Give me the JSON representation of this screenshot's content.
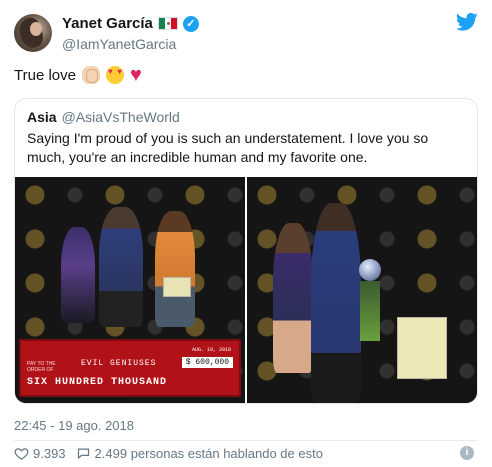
{
  "author": {
    "display_name": "Yanet García",
    "handle": "@IamYanetGarcia",
    "verified_icon": "check-icon"
  },
  "tweet": {
    "text": "True love",
    "emojis": [
      "clapping-hands-icon",
      "heart-eyes-icon",
      "red-heart-icon"
    ]
  },
  "quoted": {
    "name": "Asia",
    "handle": "@AsiaVsTheWorld",
    "text": "Saying I'm proud of you is such an understatement. I love you so much, you're an incredible human and my favorite one."
  },
  "check": {
    "pay_to": "PAY TO THE ORDER OF",
    "payee": "EVIL GENIUSES",
    "amount": "$ 600,000",
    "amount_words": "SIX HUNDRED THOUSAND",
    "date": "AUG. 19, 2018"
  },
  "meta": {
    "timestamp": "22:45 - 19 ago. 2018",
    "likes": "9.393",
    "talking": "2.499 personas están hablando de esto"
  },
  "colors": {
    "brand": "#1da1f2",
    "heart": "#e0245e",
    "muted": "#657786"
  }
}
